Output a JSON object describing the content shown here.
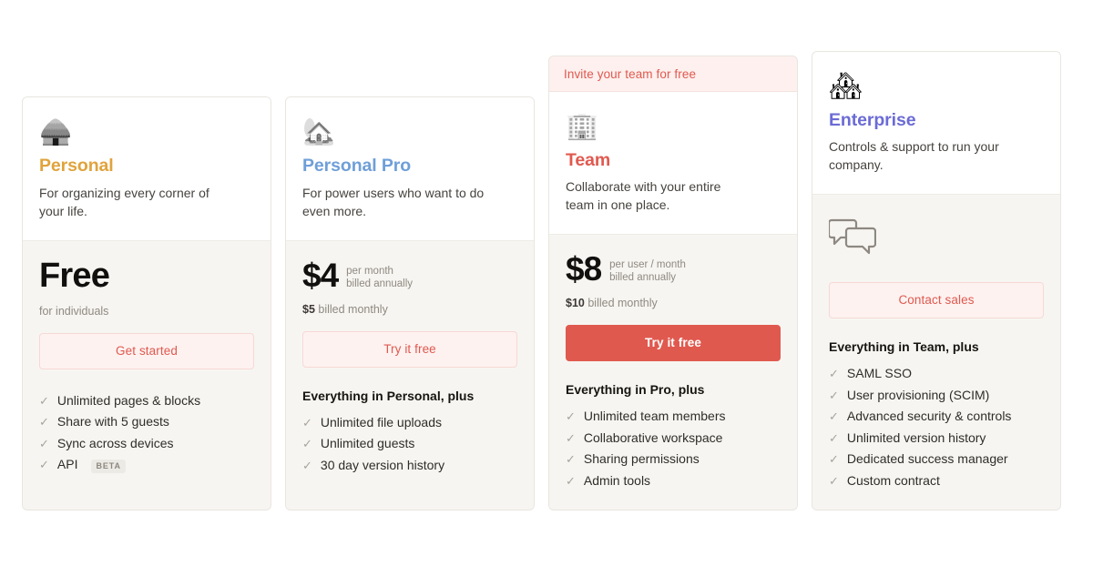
{
  "page": {
    "background": "#ffffff",
    "accent_red": "#e0594f",
    "card_bg": "#f7f5f1",
    "card_border": "#e9e6e0"
  },
  "plans": [
    {
      "id": "personal",
      "icon": "hut-icon",
      "icon_glyph": "🛖",
      "name": "Personal",
      "name_color": "#e0a33c",
      "tagline": "For organizing every corner of your life.",
      "price_amount": "Free",
      "price_unit_lines": [],
      "price_sub_plain": "for individuals",
      "price_sub_bold": "",
      "price_sub_rest": "",
      "cta_label": "Get started",
      "cta_style": "outline",
      "feature_heading": "",
      "features": [
        {
          "label": "Unlimited pages & blocks",
          "badge": ""
        },
        {
          "label": "Share with 5 guests",
          "badge": ""
        },
        {
          "label": "Sync across devices",
          "badge": ""
        },
        {
          "label": "API",
          "badge": "BETA"
        }
      ]
    },
    {
      "id": "personal-pro",
      "icon": "house-with-garden-icon",
      "icon_glyph": "🏡",
      "name": "Personal Pro",
      "name_color": "#6f9fd8",
      "tagline": "For power users who want to do even more.",
      "price_amount": "$4",
      "price_unit_lines": [
        "per month",
        "billed annually"
      ],
      "price_sub_plain": "",
      "price_sub_bold": "$5",
      "price_sub_rest": "billed monthly",
      "cta_label": "Try it free",
      "cta_style": "outline",
      "feature_heading": "Everything in Personal, plus",
      "features": [
        {
          "label": "Unlimited file uploads",
          "badge": ""
        },
        {
          "label": "Unlimited guests",
          "badge": ""
        },
        {
          "label": "30 day version history",
          "badge": ""
        }
      ]
    },
    {
      "id": "team",
      "icon": "office-building-icon",
      "icon_glyph": "🏢",
      "name": "Team",
      "name_color": "#e0594f",
      "tagline": "Collaborate with your entire team in one place.",
      "price_amount": "$8",
      "price_unit_lines": [
        "per user / month",
        "billed annually"
      ],
      "price_sub_plain": "",
      "price_sub_bold": "$10",
      "price_sub_rest": "billed monthly",
      "cta_label": "Try it free",
      "cta_style": "primary",
      "banner": "Invite your team for free",
      "feature_heading": "Everything in Pro, plus",
      "features": [
        {
          "label": "Unlimited team members",
          "badge": ""
        },
        {
          "label": "Collaborative workspace",
          "badge": ""
        },
        {
          "label": "Sharing permissions",
          "badge": ""
        },
        {
          "label": "Admin tools",
          "badge": ""
        }
      ]
    },
    {
      "id": "enterprise",
      "icon": "cityscape-icon",
      "icon_glyph": "🏘",
      "name": "Enterprise",
      "name_color": "#6b6bd6",
      "tagline": "Controls & support to run your company.",
      "price_amount": "",
      "price_unit_lines": [],
      "price_sub_plain": "",
      "price_sub_bold": "",
      "price_sub_rest": "",
      "price_icon": "speech-bubbles-icon",
      "cta_label": "Contact sales",
      "cta_style": "outline",
      "feature_heading": "Everything in Team, plus",
      "features": [
        {
          "label": "SAML SSO",
          "badge": ""
        },
        {
          "label": "User provisioning (SCIM)",
          "badge": ""
        },
        {
          "label": "Advanced security & controls",
          "badge": ""
        },
        {
          "label": "Unlimited version history",
          "badge": ""
        },
        {
          "label": "Dedicated success manager",
          "badge": ""
        },
        {
          "label": "Custom contract",
          "badge": ""
        }
      ]
    }
  ]
}
